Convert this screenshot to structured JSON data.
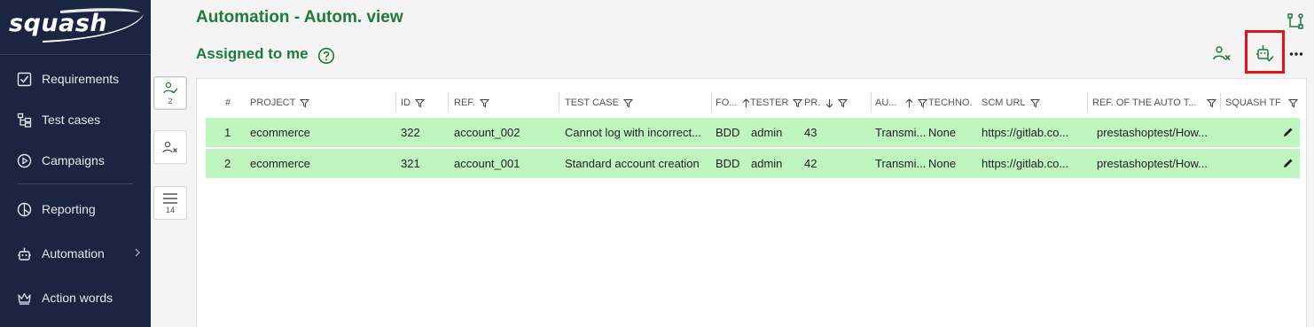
{
  "app": {
    "logo_text": "squash"
  },
  "sidebar": {
    "items": [
      {
        "label": "Requirements",
        "icon": "requirements-icon"
      },
      {
        "label": "Test cases",
        "icon": "test-cases-icon"
      },
      {
        "label": "Campaigns",
        "icon": "campaigns-icon"
      },
      {
        "label": "Reporting",
        "icon": "reporting-icon"
      },
      {
        "label": "Automation",
        "icon": "robot-icon"
      },
      {
        "label": "Action words",
        "icon": "crown-icon"
      }
    ]
  },
  "toolbar": {
    "assigned_count": "2",
    "list_count": "14"
  },
  "header": {
    "title": "Automation - Autom. view",
    "subtitle": "Assigned to me"
  },
  "table": {
    "columns": [
      "#",
      "PROJECT",
      "ID",
      "REF.",
      "TEST CASE",
      "FO...",
      "TESTER",
      "PR.",
      "AU...",
      "TECHNO.",
      "SCM URL",
      "REF. OF THE AUTO T...",
      "SQUASH TF"
    ],
    "rows": [
      {
        "num": "1",
        "project": "ecommerce",
        "id": "322",
        "ref": "account_002",
        "test_case": "Cannot log with incorrect...",
        "format": "BDD",
        "tester": "admin",
        "priority": "43",
        "automation": "Transmi...",
        "techno": "None",
        "scm_url": "https://gitlab.co...",
        "auto_ref": "prestashoptest/How..."
      },
      {
        "num": "2",
        "project": "ecommerce",
        "id": "321",
        "ref": "account_001",
        "test_case": "Standard account creation",
        "format": "BDD",
        "tester": "admin",
        "priority": "42",
        "automation": "Transmi...",
        "techno": "None",
        "scm_url": "https://gitlab.co...",
        "auto_ref": "prestashoptest/How..."
      }
    ]
  },
  "colors": {
    "sidebar_bg": "#1b2440",
    "accent_green": "#1f7a3d",
    "row_highlight": "#bff5be",
    "focus_box": "#e0151a"
  }
}
